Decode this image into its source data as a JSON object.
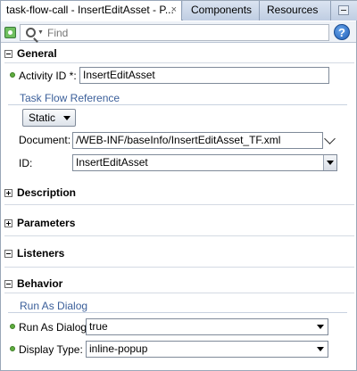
{
  "tabs": {
    "active_label": "task-flow-call - InsertEditAsset - P...",
    "close_glyph": "×",
    "components_label": "Components",
    "resources_label": "Resources"
  },
  "toolbar": {
    "find_placeholder": "Find",
    "help_glyph": "?"
  },
  "general": {
    "title": "General",
    "activity_id_label": "Activity ID *:",
    "activity_id_value": "InsertEditAsset",
    "task_flow_reference": {
      "title": "Task Flow Reference",
      "mode_value": "Static",
      "document_label": "Document:",
      "document_value": "/WEB-INF/baseInfo/InsertEditAsset_TF.xml",
      "id_label": "ID:",
      "id_value": "InsertEditAsset"
    }
  },
  "sections": {
    "description": "Description",
    "parameters": "Parameters",
    "listeners": "Listeners",
    "behavior": "Behavior"
  },
  "behavior": {
    "run_as_dialog_title": "Run As Dialog",
    "run_as_dialog_label": "Run As Dialog:",
    "run_as_dialog_value": "true",
    "display_type_label": "Display Type:",
    "display_type_value": "inline-popup"
  }
}
